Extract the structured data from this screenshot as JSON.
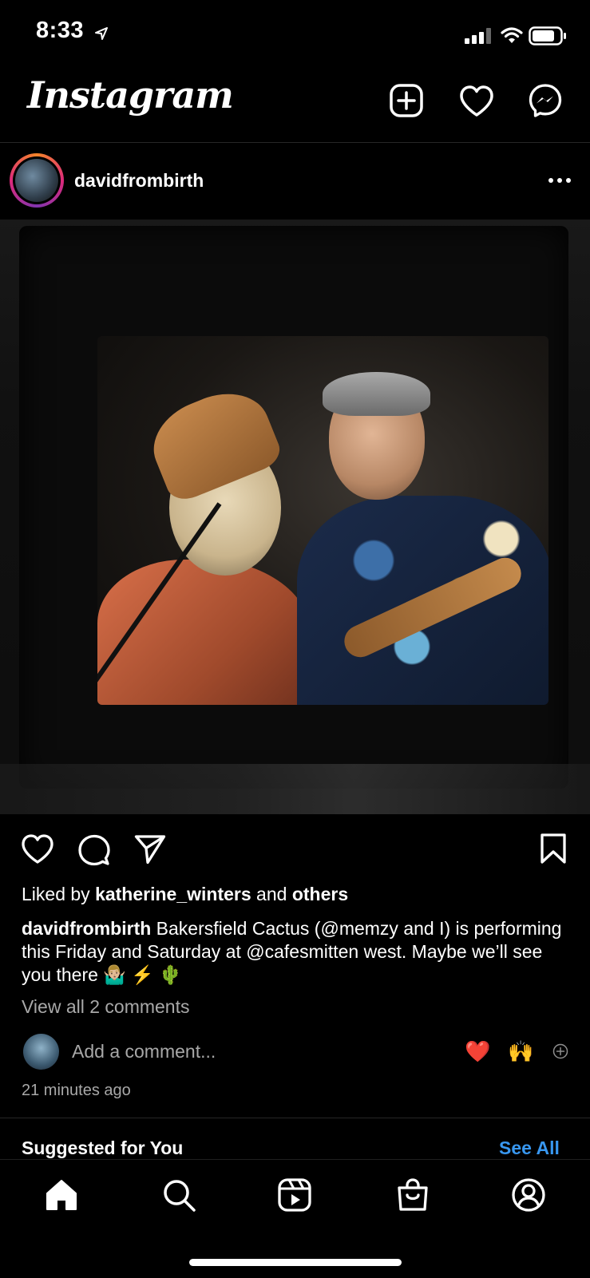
{
  "status_bar": {
    "time": "8:33"
  },
  "header": {
    "logo": "Instagram"
  },
  "post": {
    "username": "davidfrombirth",
    "likes_prefix": "Liked by ",
    "liked_by_user": "katherine_winters",
    "likes_middle": " and ",
    "likes_suffix": "others",
    "caption_user": "davidfrombirth",
    "caption_text": " Bakersfield Cactus (@memzy and I) is performing this Friday and Saturday at @cafesmitten west. Maybe we’ll see you there 🤷🏼‍♂️ ⚡️ 🌵",
    "view_comments": "View all 2 comments",
    "comment_placeholder": "Add a comment...",
    "quick_reactions": [
      "❤️",
      "🙌"
    ],
    "timestamp": "21 minutes ago"
  },
  "suggested": {
    "title": "Suggested for You",
    "see_all": "See All"
  },
  "colors": {
    "background": "#000000",
    "link": "#3897f0",
    "muted": "#a8a8a8"
  },
  "icons": {
    "header": [
      "new-post-icon",
      "activity-heart-icon",
      "messenger-icon"
    ],
    "actions": [
      "like-icon",
      "comment-icon",
      "share-icon",
      "save-icon"
    ],
    "tabs": [
      "home-icon",
      "search-icon",
      "reels-icon",
      "shop-icon",
      "profile-icon"
    ]
  }
}
